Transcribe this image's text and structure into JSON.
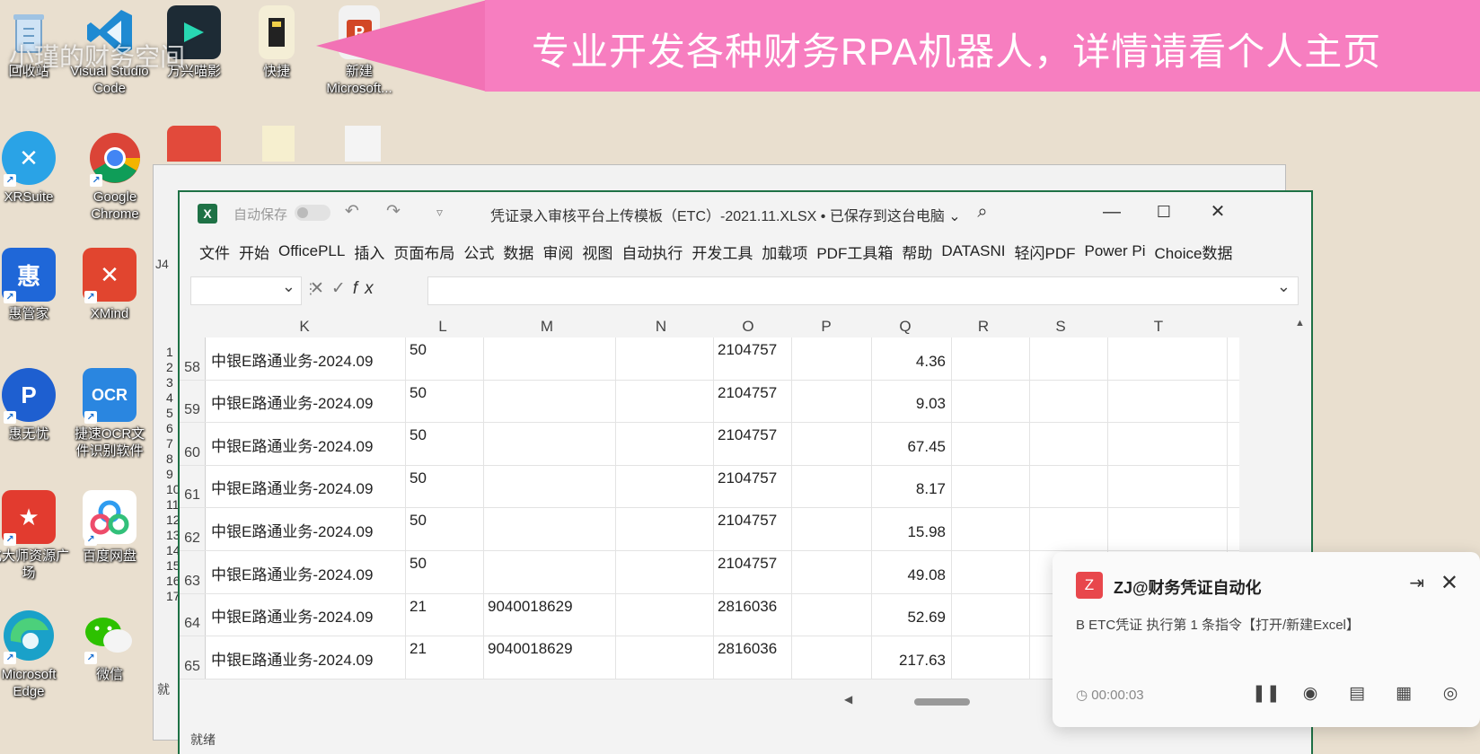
{
  "banner": {
    "text": "专业开发各种财务RPA机器人，详情请看个人主页",
    "watermark": "小瑾的财务空间"
  },
  "desktop": {
    "icons": [
      {
        "label": "回收站"
      },
      {
        "label": "Visual Studio Code"
      },
      {
        "label": "万兴喵影"
      },
      {
        "label": "快捷"
      },
      {
        "label": "新建 Microsoft..."
      },
      {
        "label": "XRSuite"
      },
      {
        "label": "Google Chrome"
      },
      {
        "label": "惠管家"
      },
      {
        "label": "XMind"
      },
      {
        "label": "惠无忧"
      },
      {
        "label": "捷速OCR文件识别软件"
      },
      {
        "label": "化大师资源广场"
      },
      {
        "label": "百度网盘"
      },
      {
        "label": "Microsoft Edge"
      },
      {
        "label": "微信"
      }
    ]
  },
  "back_window": {
    "row_numbers": [
      "1",
      "2",
      "3",
      "4",
      "5",
      "6",
      "7",
      "8",
      "9",
      "10",
      "11",
      "12",
      "13",
      "14",
      "15",
      "16",
      "17"
    ],
    "status": "就",
    "cell_ref": "J4"
  },
  "excel": {
    "autosave_label": "自动保存",
    "title": "凭证录入审核平台上传模板（ETC）-2021.11.XLSX • 已保存到这台电脑 ⌄",
    "ribbon_tabs": [
      "文件",
      "开始",
      "OfficePLL",
      "插入",
      "页面布局",
      "公式",
      "数据",
      "审阅",
      "视图",
      "自动执行",
      "开发工具",
      "加载项",
      "PDF工具箱",
      "帮助",
      "DATASNI",
      "轻闪PDF",
      "Power Pi",
      "Choice数据"
    ],
    "columns": [
      "K",
      "L",
      "M",
      "N",
      "O",
      "P",
      "Q",
      "R",
      "S",
      "T"
    ],
    "rows": [
      {
        "num": "58",
        "K": "中银E路通业务-2024.09",
        "L": "50",
        "M": "",
        "O": "2104757",
        "Q": "4.36"
      },
      {
        "num": "59",
        "K": "中银E路通业务-2024.09",
        "L": "50",
        "M": "",
        "O": "2104757",
        "Q": "9.03"
      },
      {
        "num": "60",
        "K": "中银E路通业务-2024.09",
        "L": "50",
        "M": "",
        "O": "2104757",
        "Q": "67.45"
      },
      {
        "num": "61",
        "K": "中银E路通业务-2024.09",
        "L": "50",
        "M": "",
        "O": "2104757",
        "Q": "8.17"
      },
      {
        "num": "62",
        "K": "中银E路通业务-2024.09",
        "L": "50",
        "M": "",
        "O": "2104757",
        "Q": "15.98"
      },
      {
        "num": "63",
        "K": "中银E路通业务-2024.09",
        "L": "50",
        "M": "",
        "O": "2104757",
        "Q": "49.08"
      },
      {
        "num": "64",
        "K": "中银E路通业务-2024.09",
        "L": "21",
        "M": "9040018629",
        "O": "2816036",
        "Q": "52.69"
      },
      {
        "num": "65",
        "K": "中银E路通业务-2024.09",
        "L": "21",
        "M": "9040018629",
        "O": "2816036",
        "Q": "217.63"
      }
    ],
    "status_text": "就绪"
  },
  "toast": {
    "icon_letter": "Z",
    "title": "ZJ@财务凭证自动化",
    "message": "B ETC凭证 执行第 1 条指令【打开/新建Excel】",
    "time": "00:00:03"
  }
}
